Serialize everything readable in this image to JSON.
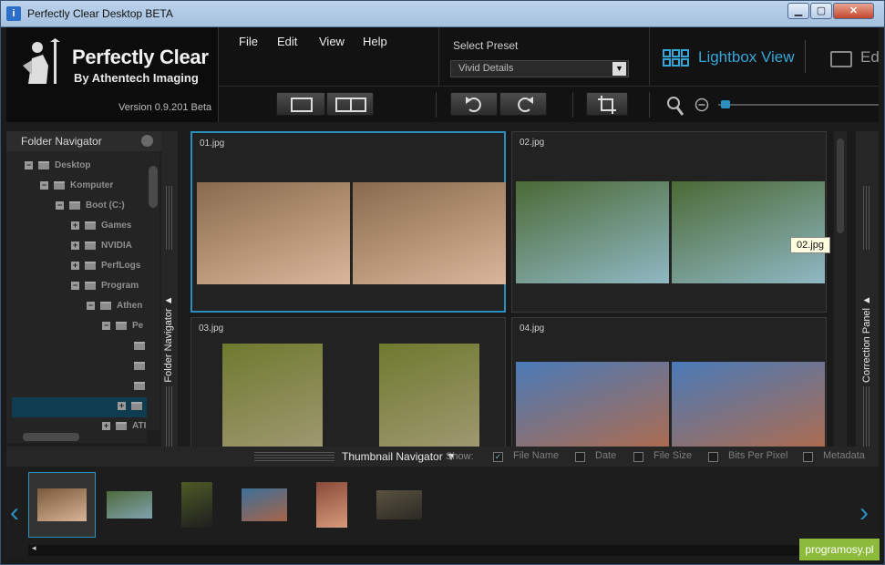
{
  "window": {
    "title": "Perfectly Clear Desktop BETA",
    "minimize": "▁",
    "maximize": "▢",
    "close": "✕"
  },
  "logo": {
    "title": "Perfectly Clear",
    "subtitle": "By Athentech Imaging",
    "version": "Version 0.9.201 Beta"
  },
  "menu": [
    "File",
    "Edit",
    "View",
    "Help"
  ],
  "preset": {
    "label": "Select Preset",
    "value": "Vivid Details",
    "arrow": "▼"
  },
  "views": {
    "lightbox": "Lightbox View",
    "edit": "Ed"
  },
  "folder_navigator": {
    "title": "Folder Navigator",
    "items": [
      {
        "label": "Desktop",
        "exp": "−"
      },
      {
        "label": "Komputer",
        "exp": "−"
      },
      {
        "label": "Boot (C:)",
        "exp": "−"
      },
      {
        "label": "Games",
        "exp": "+"
      },
      {
        "label": "NVIDIA",
        "exp": "+"
      },
      {
        "label": "PerfLogs",
        "exp": "+"
      },
      {
        "label": "Program",
        "exp": "−"
      },
      {
        "label": "Athen",
        "exp": "−"
      },
      {
        "label": "Pe",
        "exp": "−"
      },
      {
        "label": "",
        "exp": ""
      },
      {
        "label": "",
        "exp": ""
      },
      {
        "label": "",
        "exp": ""
      },
      {
        "label": "",
        "exp": "+"
      },
      {
        "label": "ATI",
        "exp": "+"
      }
    ]
  },
  "side_labels": {
    "folder": "Folder Navigator ▲",
    "correction": "Correction Panel ▲"
  },
  "images": [
    {
      "name": "01.jpg",
      "colors": [
        "#8a6a4c",
        "#d9b79a"
      ]
    },
    {
      "name": "02.jpg",
      "colors": [
        "#4b6a35",
        "#8fb8c4"
      ]
    },
    {
      "name": "03.jpg",
      "colors": [
        "#6e7a2e",
        "#a89d7c"
      ]
    },
    {
      "name": "04.jpg",
      "colors": [
        "#4a7ab8",
        "#b86a44"
      ]
    }
  ],
  "tooltip": "02.jpg",
  "thumbnail_navigator": {
    "label": "Thumbnail Navigator ▼",
    "show": "Show:",
    "options": [
      {
        "label": "File Name",
        "checked": true,
        "mark": "✓"
      },
      {
        "label": "Date",
        "checked": false,
        "mark": ""
      },
      {
        "label": "File Size",
        "checked": false,
        "mark": ""
      },
      {
        "label": "Bits Per Pixel",
        "checked": false,
        "mark": ""
      },
      {
        "label": "Metadata",
        "checked": false,
        "mark": ""
      }
    ]
  },
  "filmstrip": [
    {
      "colors": [
        "#7a5a3a",
        "#d7b495"
      ]
    },
    {
      "colors": [
        "#4f6b3d",
        "#7fa2ae"
      ]
    },
    {
      "colors": [
        "#4e5a26",
        "#1e1e1e"
      ]
    },
    {
      "colors": [
        "#3d6f9a",
        "#a76447"
      ]
    },
    {
      "colors": [
        "#8a4a3a",
        "#d79a7a"
      ]
    },
    {
      "colors": [
        "#5a5240",
        "#2d2a25"
      ]
    }
  ],
  "nav": {
    "prev": "‹",
    "next": "›"
  },
  "watermark": "programosy.pl"
}
